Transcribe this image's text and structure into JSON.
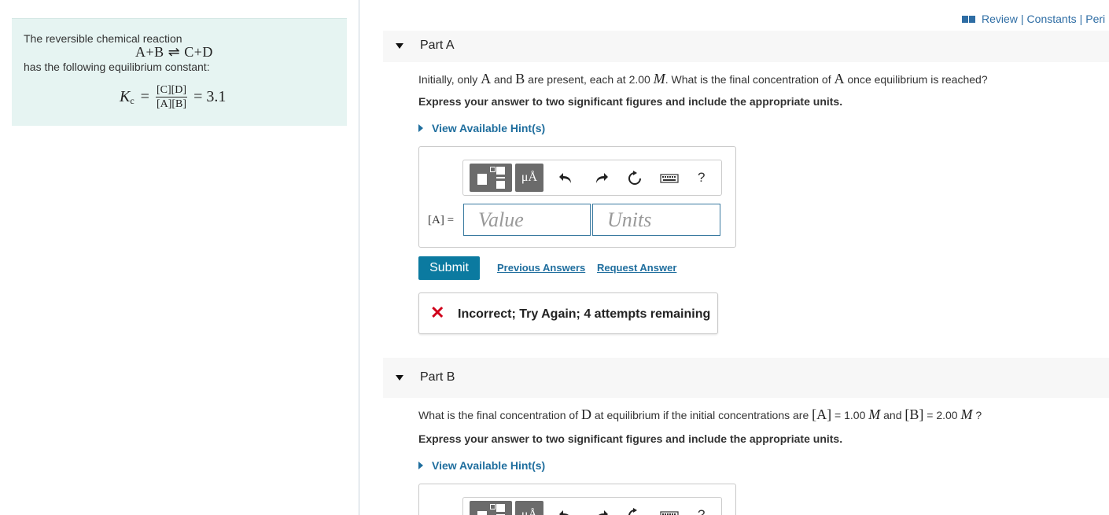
{
  "left_panel": {
    "intro": "The reversible chemical reaction",
    "reaction": "A+B ⇌ C+D",
    "constant_intro": "has the following equilibrium constant:",
    "kc_symbol": "K",
    "kc_subscript": "c",
    "kc_numerator": "[C][D]",
    "kc_denominator": "[A][B]",
    "kc_value": "= 3.1"
  },
  "top_links": {
    "review": "Review",
    "constants": "Constants",
    "periodic": "Peri",
    "separator": "|"
  },
  "part_a": {
    "title": "Part A",
    "q_pre": "Initially, only ",
    "q_a": "A",
    "q_and": " and ",
    "q_b": "B",
    "q_mid": " are present, each at 2.00 ",
    "q_m": "M",
    "q_post": ". What is the final concentration of ",
    "q_a2": "A",
    "q_end": " once equilibrium is reached?",
    "instruction": "Express your answer to two significant figures and include the appropriate units.",
    "hint": "View Available Hint(s)",
    "toolbar": {
      "mu_label": "μÅ",
      "help": "?"
    },
    "lhs": "[A] =",
    "value_placeholder": "Value",
    "units_placeholder": "Units",
    "submit": "Submit",
    "previous_answers": "Previous Answers",
    "request_answer": "Request Answer",
    "feedback_mark": "✕",
    "feedback": "Incorrect; Try Again; 4 attempts remaining"
  },
  "part_b": {
    "title": "Part B",
    "q_pre": "What is the final concentration of ",
    "q_d": "D",
    "q_mid": " at equilibrium if the initial concentrations are ",
    "q_a": "[A]",
    "q_a_val": " = 1.00 ",
    "q_m1": "M",
    "q_and": " and ",
    "q_b": "[B]",
    "q_b_val": " = 2.00 ",
    "q_m2": "M",
    "q_end": " ?",
    "instruction": "Express your answer to two significant figures and include the appropriate units.",
    "hint": "View Available Hint(s)",
    "toolbar": {
      "mu_label": "μÅ",
      "help": "?"
    }
  },
  "colors": {
    "panel_bg": "#e6f4f2",
    "link": "#1f6e9e",
    "submit_bg": "#0b7aa0",
    "error": "#d0021b"
  }
}
